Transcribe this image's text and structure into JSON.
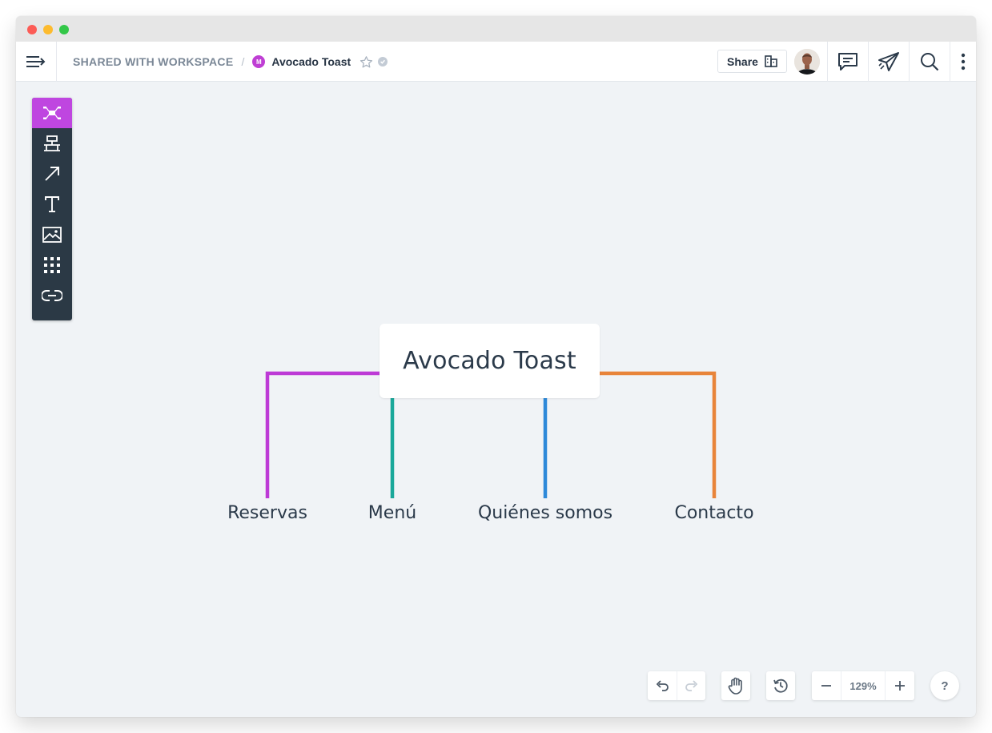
{
  "breadcrumb": {
    "workspace": "SHARED WITH WORKSPACE",
    "separator": "/",
    "doc_badge": "M",
    "doc_title": "Avocado Toast"
  },
  "header": {
    "share_label": "Share",
    "icons": [
      "menu-arrow-icon",
      "star-icon",
      "verified-icon",
      "building-icon",
      "comment-icon",
      "send-icon",
      "search-icon",
      "more-vertical-icon"
    ]
  },
  "toolbar": {
    "tools": [
      "mindmap-tool-icon",
      "node-tool-icon",
      "arrow-tool-icon",
      "text-tool-icon",
      "image-tool-icon",
      "grid-tool-icon",
      "link-tool-icon"
    ],
    "active_index": 0
  },
  "mindmap": {
    "center": "Avocado Toast",
    "children": [
      {
        "label": "Reservas",
        "color": "#bd3ad6"
      },
      {
        "label": "Menú",
        "color": "#1aa89a"
      },
      {
        "label": "Quiénes somos",
        "color": "#2d89d9"
      },
      {
        "label": "Contacto",
        "color": "#e8843a"
      }
    ]
  },
  "controls": {
    "zoom": "129%",
    "help": "?",
    "icons": [
      "undo-icon",
      "redo-icon",
      "hand-icon",
      "history-icon",
      "zoom-out-icon",
      "zoom-in-icon"
    ]
  },
  "colors": {
    "accent": "#bf46e0",
    "toolbar_bg": "#2b3945",
    "canvas_bg": "#f0f3f6"
  }
}
